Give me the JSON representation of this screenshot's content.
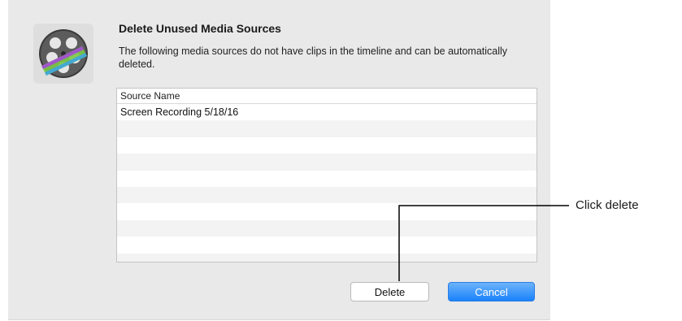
{
  "dialog": {
    "title": "Delete Unused Media Sources",
    "message": "The following media sources do not have clips in the timeline and can be automatically deleted.",
    "list": {
      "column_header": "Source Name",
      "rows": [
        "Screen Recording 5/18/16",
        "",
        "",
        "",
        "",
        "",
        "",
        "",
        "",
        ""
      ]
    },
    "buttons": {
      "delete_label": "Delete",
      "cancel_label": "Cancel"
    },
    "app_icon": "film-reel-icon"
  },
  "annotation": {
    "label": "Click delete"
  },
  "colors": {
    "dialog_bg": "#e9e9e9",
    "primary_button": "#1a82fb"
  }
}
